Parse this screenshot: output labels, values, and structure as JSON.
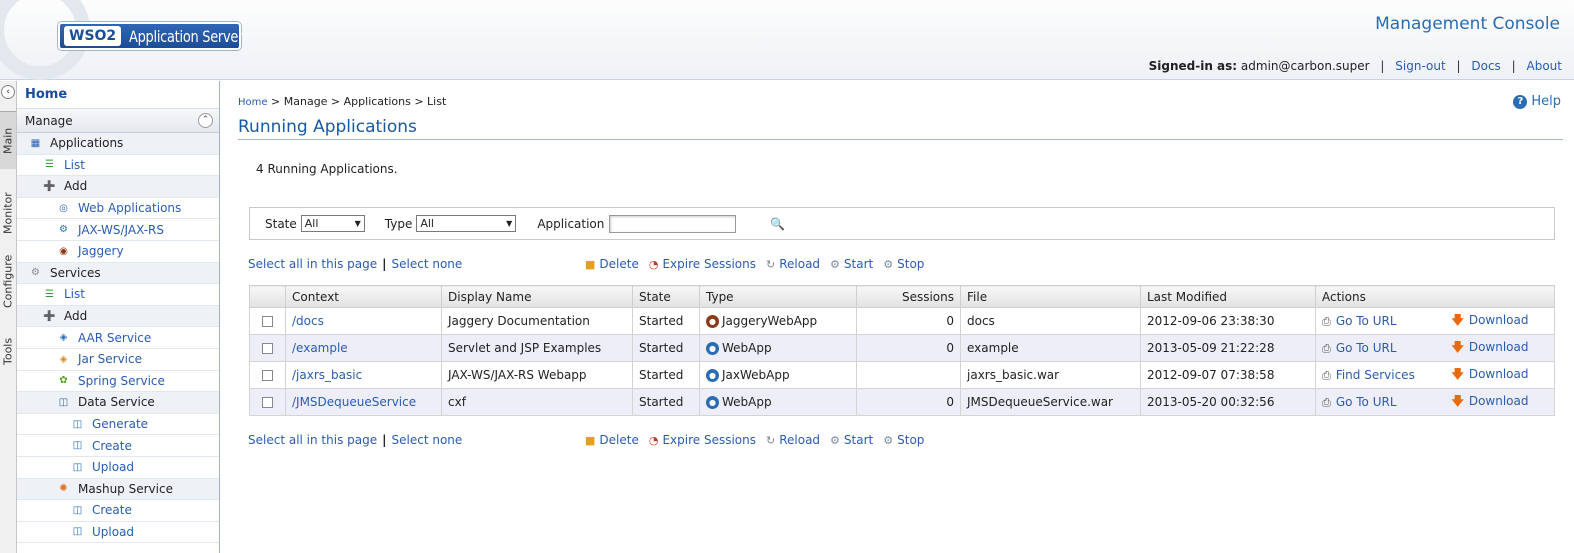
{
  "header": {
    "logo_prefix": "WSO2",
    "logo_product": "Application Server",
    "console_title": "Management Console",
    "signed_in_label": "Signed-in as:",
    "signed_in_user": "admin@carbon.super",
    "links": [
      "Sign-out",
      "Docs",
      "About"
    ]
  },
  "vertical_tabs": [
    "Main",
    "Monitor",
    "Configure",
    "Tools"
  ],
  "sidebar": {
    "home": "Home",
    "section": "Manage",
    "items": [
      {
        "label": "Applications",
        "kind": "group",
        "indent": 0,
        "icon": "applications-icon"
      },
      {
        "label": "List",
        "kind": "link",
        "indent": 1,
        "icon": "list-icon"
      },
      {
        "label": "Add",
        "kind": "group",
        "indent": 1,
        "icon": "add-icon"
      },
      {
        "label": "Web Applications",
        "kind": "link",
        "indent": 2,
        "icon": "webapp-icon"
      },
      {
        "label": "JAX-WS/JAX-RS",
        "kind": "link",
        "indent": 2,
        "icon": "jax-icon"
      },
      {
        "label": "Jaggery",
        "kind": "link",
        "indent": 2,
        "icon": "jaggery-icon"
      },
      {
        "label": "Services",
        "kind": "group",
        "indent": 0,
        "icon": "services-icon"
      },
      {
        "label": "List",
        "kind": "link",
        "indent": 1,
        "icon": "list-icon"
      },
      {
        "label": "Add",
        "kind": "group",
        "indent": 1,
        "icon": "add-icon"
      },
      {
        "label": "AAR Service",
        "kind": "link",
        "indent": 2,
        "icon": "aar-icon"
      },
      {
        "label": "Jar Service",
        "kind": "link",
        "indent": 2,
        "icon": "jar-icon"
      },
      {
        "label": "Spring Service",
        "kind": "link",
        "indent": 2,
        "icon": "spring-icon"
      },
      {
        "label": "Data Service",
        "kind": "group",
        "indent": 2,
        "icon": "data-service-icon"
      },
      {
        "label": "Generate",
        "kind": "link",
        "indent": 3,
        "icon": "generate-icon"
      },
      {
        "label": "Create",
        "kind": "link",
        "indent": 3,
        "icon": "create-icon"
      },
      {
        "label": "Upload",
        "kind": "link",
        "indent": 3,
        "icon": "upload-icon"
      },
      {
        "label": "Mashup Service",
        "kind": "group",
        "indent": 2,
        "icon": "mashup-icon"
      },
      {
        "label": "Create",
        "kind": "link",
        "indent": 3,
        "icon": "create-icon"
      },
      {
        "label": "Upload",
        "kind": "link",
        "indent": 3,
        "icon": "upload-icon"
      }
    ]
  },
  "main": {
    "breadcrumb": {
      "home": "Home",
      "rest": "> Manage > Applications > List"
    },
    "help": "Help",
    "title": "Running Applications",
    "count_text": "4 Running Applications.",
    "filter": {
      "state_label": "State",
      "state_value": "All",
      "type_label": "Type",
      "type_value": "All",
      "app_label": "Application",
      "app_value": ""
    },
    "select_all": "Select all in this page",
    "select_none": "Select none",
    "actions": {
      "delete": "Delete",
      "expire": "Expire Sessions",
      "reload": "Reload",
      "start": "Start",
      "stop": "Stop"
    },
    "table": {
      "headers": [
        "",
        "Context",
        "Display Name",
        "State",
        "Type",
        "Sessions",
        "File",
        "Last Modified",
        "Actions",
        ""
      ],
      "rows": [
        {
          "context": "/docs",
          "display": "Jaggery Documentation",
          "state": "Started",
          "type": "JaggeryWebApp",
          "type_icon": "jaggery-icon",
          "sessions": "0",
          "file": "docs",
          "modified": "2012-09-06 23:38:30",
          "action": "Go To URL",
          "download": "Download"
        },
        {
          "context": "/example",
          "display": "Servlet and JSP Examples",
          "state": "Started",
          "type": "WebApp",
          "type_icon": "webapp-icon",
          "sessions": "0",
          "file": "example",
          "modified": "2013-05-09 21:22:28",
          "action": "Go To URL",
          "download": "Download"
        },
        {
          "context": "/jaxrs_basic",
          "display": "JAX-WS/JAX-RS Webapp",
          "state": "Started",
          "type": "JaxWebApp",
          "type_icon": "jax-icon",
          "sessions": "",
          "file": "jaxrs_basic.war",
          "modified": "2012-09-07 07:38:58",
          "action": "Find Services",
          "download": "Download"
        },
        {
          "context": "/JMSDequeueService",
          "display": "cxf",
          "state": "Started",
          "type": "WebApp",
          "type_icon": "webapp-icon",
          "sessions": "0",
          "file": "JMSDequeueService.war",
          "modified": "2013-05-20 00:32:56",
          "action": "Go To URL",
          "download": "Download"
        }
      ]
    }
  }
}
